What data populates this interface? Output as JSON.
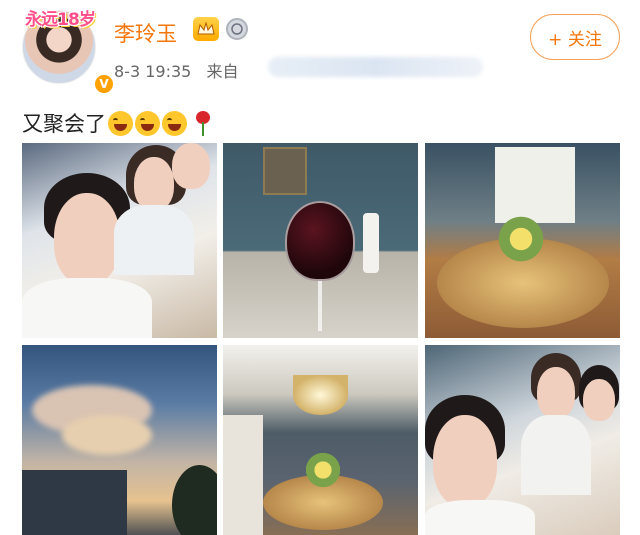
{
  "user": {
    "name": "李玲玉",
    "avatar_frame_text": "永远18岁",
    "verified_badge": "V"
  },
  "post": {
    "date": "8-3",
    "time": "19:35",
    "source_prefix": "来自",
    "text": "又聚会了"
  },
  "actions": {
    "follow_label": "+ 关注"
  },
  "icons": {
    "vip": "crown-badge-icon",
    "medal": "medal-icon",
    "emoji": [
      "laughing-emoji-icon",
      "laughing-emoji-icon",
      "laughing-emoji-icon",
      "rose-emoji-icon"
    ]
  },
  "colors": {
    "accent": "#f5760a",
    "verified": "#ffa200",
    "text": "#222222",
    "meta": "#666666"
  },
  "photos": [
    "selfie-at-dinner",
    "red-wine-glass",
    "round-dining-table",
    "sunset-sky",
    "chandelier-dining-room",
    "friends-selfie"
  ]
}
